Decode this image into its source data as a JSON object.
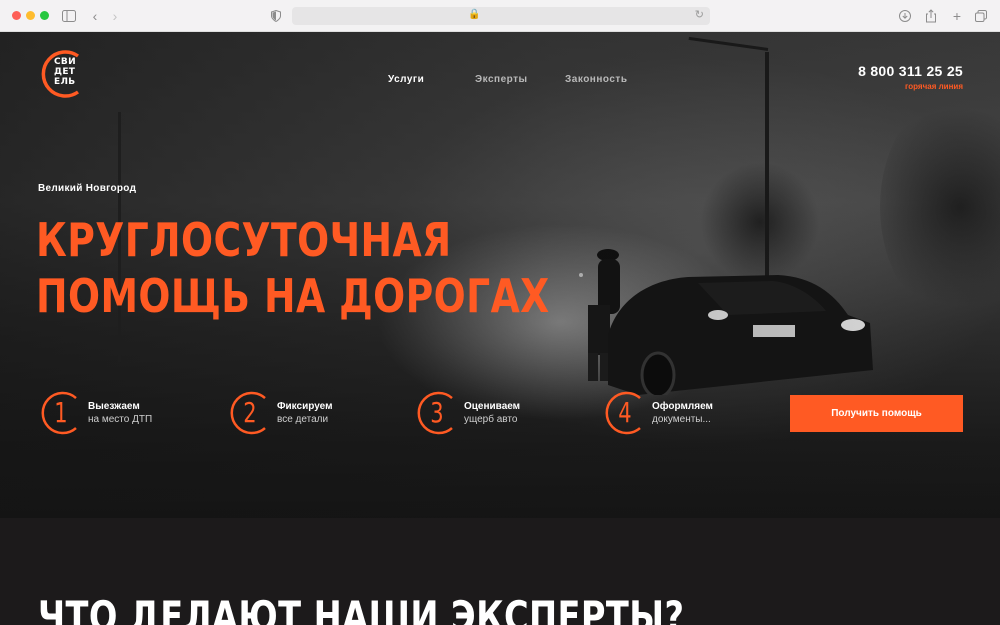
{
  "colors": {
    "accent": "#ff5a23",
    "background": "#1c1a1b"
  },
  "browser": {
    "icons": [
      "sidebar-icon",
      "back-icon",
      "forward-icon",
      "shield-icon",
      "lock-icon",
      "reload-icon",
      "download-icon",
      "share-icon",
      "new-tab-icon",
      "tabs-icon"
    ]
  },
  "logo": {
    "line1": "СВИ",
    "line2": "ДЕТ",
    "line3": "ЕЛЬ"
  },
  "nav": {
    "services": "Услуги",
    "experts": "Эксперты",
    "legality": "Законность"
  },
  "contact": {
    "phone": "8 800 311 25 25",
    "hotline": "горячая линия"
  },
  "hero": {
    "city": "Великий Новгород",
    "headline_line1": "КРУГЛОСУТОЧНАЯ",
    "headline_line2": "ПОМОЩЬ НА ДОРОГАХ"
  },
  "steps": [
    {
      "num": "1",
      "title": "Выезжаем",
      "sub": "на место ДТП"
    },
    {
      "num": "2",
      "title": "Фиксируем",
      "sub": "все детали"
    },
    {
      "num": "3",
      "title": "Оцениваем",
      "sub": "ущерб авто"
    },
    {
      "num": "4",
      "title": "Оформляем",
      "sub": "документы..."
    }
  ],
  "cta": {
    "label": "Получить помощь"
  },
  "section": {
    "title": "ЧТО ДЕЛАЮТ НАШИ ЭКСПЕРТЫ?"
  }
}
